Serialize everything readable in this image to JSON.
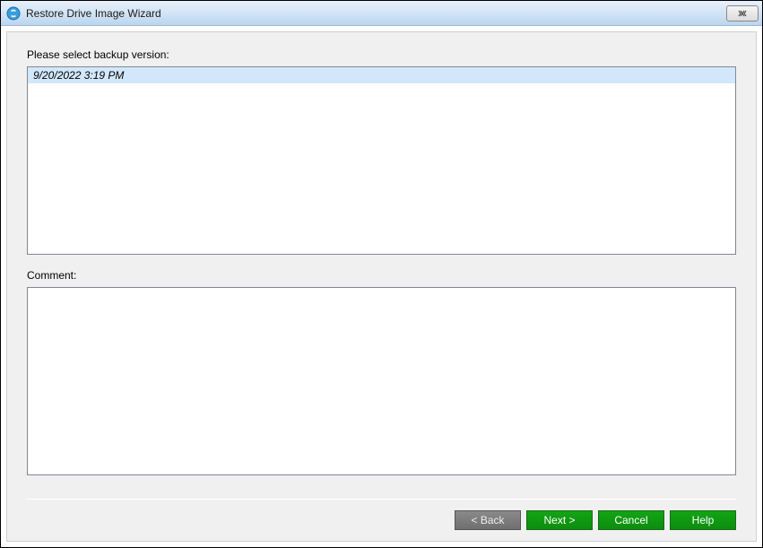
{
  "window": {
    "title": "Restore Drive Image Wizard"
  },
  "labels": {
    "select_backup": "Please select backup version:",
    "comment": "Comment:"
  },
  "backup_versions": [
    {
      "timestamp": "9/20/2022 3:19 PM",
      "selected": true
    }
  ],
  "comment_text": "",
  "buttons": {
    "back": "< Back",
    "next": "Next >",
    "cancel": "Cancel",
    "help": "Help"
  }
}
